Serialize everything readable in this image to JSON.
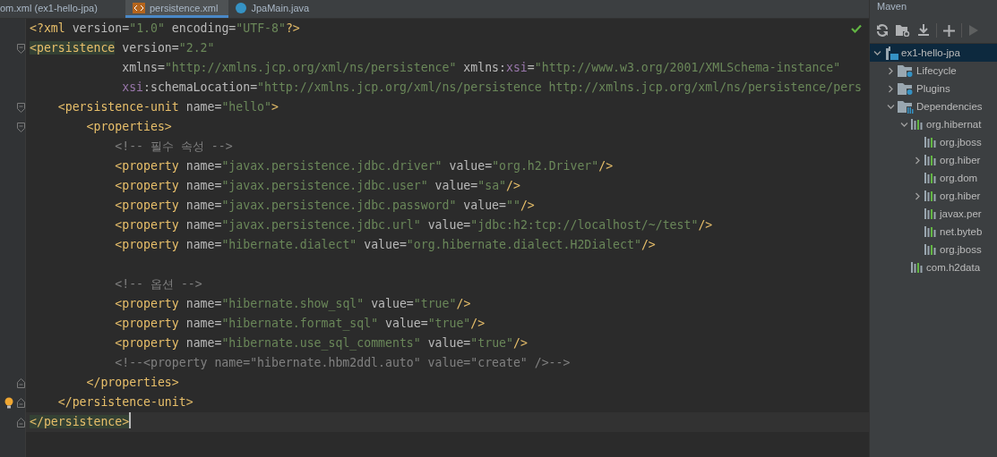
{
  "editor_tabs": [
    {
      "label": "om.xml (ex1-hello-jpa)",
      "selected": false
    },
    {
      "label": "persistence.xml",
      "selected": true
    },
    {
      "label": "JpaMain.java",
      "selected": false
    }
  ],
  "editor": {
    "lines": [
      {
        "match": false,
        "current": false,
        "tokens": [
          {
            "kind": "tag",
            "text": "<?xml"
          },
          {
            "kind": "attr",
            "text": " version"
          },
          {
            "kind": "eq",
            "text": "="
          },
          {
            "kind": "value",
            "text": "\"1.0\""
          },
          {
            "kind": "attr",
            "text": " encoding"
          },
          {
            "kind": "eq",
            "text": "="
          },
          {
            "kind": "value",
            "text": "\"UTF-8\""
          },
          {
            "kind": "tag",
            "text": "?>"
          }
        ]
      },
      {
        "match": true,
        "current": false,
        "tokens": [
          {
            "kind": "tag",
            "text": "<persistence"
          },
          {
            "kind": "attr",
            "text": " version"
          },
          {
            "kind": "eq",
            "text": "="
          },
          {
            "kind": "value",
            "text": "\"2.2\""
          }
        ]
      },
      {
        "match": false,
        "current": false,
        "tokens": [
          {
            "kind": "attr",
            "text": "xmlns"
          },
          {
            "kind": "eq",
            "text": "="
          },
          {
            "kind": "value",
            "text": "\"http://xmlns.jcp.org/xml/ns/persistence\""
          },
          {
            "kind": "attr",
            "text": " xmlns:"
          },
          {
            "kind": "ns",
            "text": "xsi"
          },
          {
            "kind": "eq",
            "text": "="
          },
          {
            "kind": "value",
            "text": "\"http://www.w3.org/2001/XMLSchema-instance\""
          }
        ]
      },
      {
        "match": false,
        "current": false,
        "tokens": [
          {
            "kind": "ns",
            "text": "xsi"
          },
          {
            "kind": "attr",
            "text": ":schemaLocation"
          },
          {
            "kind": "eq",
            "text": "="
          },
          {
            "kind": "value",
            "text": "\"http://xmlns.jcp.org/xml/ns/persistence http://xmlns.jcp.org/xml/ns/persistence/pers"
          }
        ]
      },
      {
        "match": false,
        "current": false,
        "tokens": [
          {
            "kind": "tag",
            "text": "<persistence-unit"
          },
          {
            "kind": "attr",
            "text": " name"
          },
          {
            "kind": "eq",
            "text": "="
          },
          {
            "kind": "value",
            "text": "\"hello\""
          },
          {
            "kind": "tag",
            "text": ">"
          }
        ]
      },
      {
        "match": false,
        "current": false,
        "tokens": [
          {
            "kind": "tag",
            "text": "<properties>"
          }
        ]
      },
      {
        "match": false,
        "current": false,
        "tokens": [
          {
            "kind": "comment",
            "text": "<!-- 필수 속성 -->"
          }
        ]
      },
      {
        "match": false,
        "current": false,
        "tokens": [
          {
            "kind": "tag",
            "text": "<property"
          },
          {
            "kind": "attr",
            "text": " name"
          },
          {
            "kind": "eq",
            "text": "="
          },
          {
            "kind": "value",
            "text": "\"javax.persistence.jdbc.driver\""
          },
          {
            "kind": "attr",
            "text": " value"
          },
          {
            "kind": "eq",
            "text": "="
          },
          {
            "kind": "value",
            "text": "\"org.h2.Driver\""
          },
          {
            "kind": "tag",
            "text": "/>"
          }
        ]
      },
      {
        "match": false,
        "current": false,
        "tokens": [
          {
            "kind": "tag",
            "text": "<property"
          },
          {
            "kind": "attr",
            "text": " name"
          },
          {
            "kind": "eq",
            "text": "="
          },
          {
            "kind": "value",
            "text": "\"javax.persistence.jdbc.user\""
          },
          {
            "kind": "attr",
            "text": " value"
          },
          {
            "kind": "eq",
            "text": "="
          },
          {
            "kind": "value",
            "text": "\"sa\""
          },
          {
            "kind": "tag",
            "text": "/>"
          }
        ]
      },
      {
        "match": false,
        "current": false,
        "tokens": [
          {
            "kind": "tag",
            "text": "<property"
          },
          {
            "kind": "attr",
            "text": " name"
          },
          {
            "kind": "eq",
            "text": "="
          },
          {
            "kind": "value",
            "text": "\"javax.persistence.jdbc.password\""
          },
          {
            "kind": "attr",
            "text": " value"
          },
          {
            "kind": "eq",
            "text": "="
          },
          {
            "kind": "value",
            "text": "\"\""
          },
          {
            "kind": "tag",
            "text": "/>"
          }
        ]
      },
      {
        "match": false,
        "current": false,
        "tokens": [
          {
            "kind": "tag",
            "text": "<property"
          },
          {
            "kind": "attr",
            "text": " name"
          },
          {
            "kind": "eq",
            "text": "="
          },
          {
            "kind": "value",
            "text": "\"javax.persistence.jdbc.url\""
          },
          {
            "kind": "attr",
            "text": " value"
          },
          {
            "kind": "eq",
            "text": "="
          },
          {
            "kind": "value",
            "text": "\"jdbc:h2:tcp://localhost/~/test\""
          },
          {
            "kind": "tag",
            "text": "/>"
          }
        ]
      },
      {
        "match": false,
        "current": false,
        "tokens": [
          {
            "kind": "tag",
            "text": "<property"
          },
          {
            "kind": "attr",
            "text": " name"
          },
          {
            "kind": "eq",
            "text": "="
          },
          {
            "kind": "value",
            "text": "\"hibernate.dialect\""
          },
          {
            "kind": "attr",
            "text": " value"
          },
          {
            "kind": "eq",
            "text": "="
          },
          {
            "kind": "value",
            "text": "\"org.hibernate.dialect.H2Dialect\""
          },
          {
            "kind": "tag",
            "text": "/>"
          }
        ]
      },
      {
        "match": false,
        "current": false,
        "tokens": [
          {
            "kind": "comment",
            "text": "<!-- 옵션 -->"
          }
        ]
      },
      {
        "match": false,
        "current": false,
        "tokens": [
          {
            "kind": "tag",
            "text": "<property"
          },
          {
            "kind": "attr",
            "text": " name"
          },
          {
            "kind": "eq",
            "text": "="
          },
          {
            "kind": "value",
            "text": "\"hibernate.show_sql\""
          },
          {
            "kind": "attr",
            "text": " value"
          },
          {
            "kind": "eq",
            "text": "="
          },
          {
            "kind": "value",
            "text": "\"true\""
          },
          {
            "kind": "tag",
            "text": "/>"
          }
        ]
      },
      {
        "match": false,
        "current": false,
        "tokens": [
          {
            "kind": "tag",
            "text": "<property"
          },
          {
            "kind": "attr",
            "text": " name"
          },
          {
            "kind": "eq",
            "text": "="
          },
          {
            "kind": "value",
            "text": "\"hibernate.format_sql\""
          },
          {
            "kind": "attr",
            "text": " value"
          },
          {
            "kind": "eq",
            "text": "="
          },
          {
            "kind": "value",
            "text": "\"true\""
          },
          {
            "kind": "tag",
            "text": "/>"
          }
        ]
      },
      {
        "match": false,
        "current": false,
        "tokens": [
          {
            "kind": "tag",
            "text": "<property"
          },
          {
            "kind": "attr",
            "text": " name"
          },
          {
            "kind": "eq",
            "text": "="
          },
          {
            "kind": "value",
            "text": "\"hibernate.use_sql_comments\""
          },
          {
            "kind": "attr",
            "text": " value"
          },
          {
            "kind": "eq",
            "text": "="
          },
          {
            "kind": "value",
            "text": "\"true\""
          },
          {
            "kind": "tag",
            "text": "/>"
          }
        ]
      },
      {
        "match": false,
        "current": false,
        "tokens": [
          {
            "kind": "comment",
            "text": "<!--<property name=\"hibernate.hbm2ddl.auto\" value=\"create\" />-->"
          }
        ]
      },
      {
        "match": false,
        "current": false,
        "tokens": [
          {
            "kind": "tag",
            "text": "</properties>"
          }
        ]
      },
      {
        "match": false,
        "current": false,
        "tokens": [
          {
            "kind": "tag",
            "text": "</persistence-unit>"
          }
        ]
      },
      {
        "match": true,
        "current": true,
        "tokens": [
          {
            "kind": "tag",
            "text": "</persistence>"
          }
        ]
      }
    ]
  },
  "maven": {
    "title": "Maven",
    "toolbar": [
      {
        "disabled": false
      },
      {
        "disabled": false
      },
      {
        "disabled": false
      },
      {
        "disabled": false
      },
      {
        "disabled": true
      }
    ],
    "tree": [
      {
        "label": "ex1-hello-jpa",
        "kind": "project",
        "expanded": true,
        "selected": true,
        "children": [
          {
            "label": "Lifecycle",
            "kind": "folder",
            "expanded": false,
            "selected": false
          },
          {
            "label": "Plugins",
            "kind": "folder",
            "expanded": false,
            "selected": false
          },
          {
            "label": "Dependencies",
            "kind": "deps",
            "expanded": true,
            "selected": false,
            "children": [
              {
                "label": "org.hibernat",
                "kind": "library",
                "expanded": true,
                "selected": false,
                "children": [
                  {
                    "label": "org.jboss",
                    "kind": "library",
                    "selected": false
                  },
                  {
                    "label": "org.hiber",
                    "kind": "library",
                    "expanded": false,
                    "selected": false
                  },
                  {
                    "label": "org.dom",
                    "kind": "library",
                    "selected": false
                  },
                  {
                    "label": "org.hiber",
                    "kind": "library",
                    "expanded": false,
                    "selected": false
                  },
                  {
                    "label": "javax.per",
                    "kind": "library",
                    "selected": false
                  },
                  {
                    "label": "net.byteb",
                    "kind": "library",
                    "selected": false
                  },
                  {
                    "label": "org.jboss",
                    "kind": "library",
                    "selected": false
                  }
                ]
              },
              {
                "label": "com.h2data",
                "kind": "library",
                "selected": false
              }
            ]
          }
        ]
      }
    ]
  }
}
